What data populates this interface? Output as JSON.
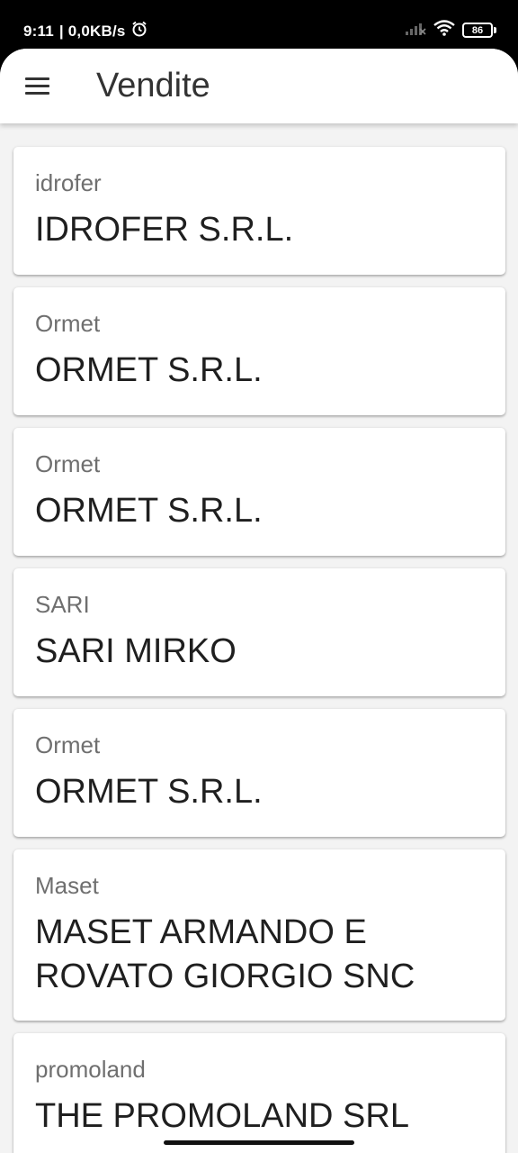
{
  "status": {
    "time": "9:11",
    "speed": "| 0,0KB/s",
    "battery": "86"
  },
  "icons": {
    "alarm": "alarm-icon",
    "signal": "signal-icon",
    "wifi": "wifi-icon",
    "battery": "battery-icon",
    "menu": "hamburger-menu-icon"
  },
  "app_bar": {
    "title": "Vendite"
  },
  "list": [
    {
      "sub": "idrofer",
      "title": "IDROFER S.R.L."
    },
    {
      "sub": "Ormet",
      "title": "ORMET S.R.L."
    },
    {
      "sub": "Ormet",
      "title": "ORMET S.R.L."
    },
    {
      "sub": "SARI",
      "title": "SARI MIRKO"
    },
    {
      "sub": "Ormet",
      "title": "ORMET S.R.L."
    },
    {
      "sub": "Maset",
      "title": "MASET ARMANDO E ROVATO GIORGIO SNC"
    },
    {
      "sub": "promoland",
      "title": "THE PROMOLAND SRL"
    }
  ]
}
